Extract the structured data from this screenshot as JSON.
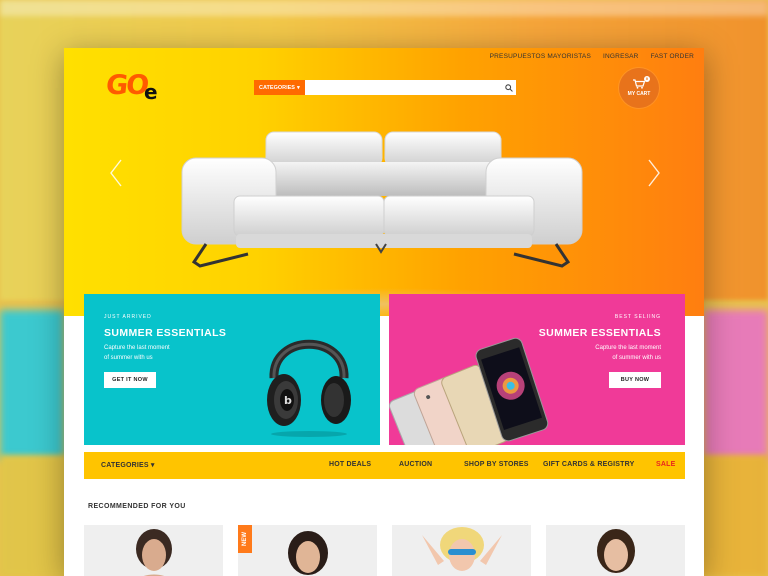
{
  "top_links": [
    "PRESUPUESTOS MAYORISTAS",
    "INGRESAR",
    "FAST ORDER"
  ],
  "logo": {
    "text_main": "GO",
    "text_small": "e"
  },
  "search": {
    "category_label": "CATEGORIES",
    "placeholder": "",
    "icon": "search-icon"
  },
  "cart": {
    "label": "MY CART",
    "count": "0",
    "icon": "cart-icon"
  },
  "hero": {
    "product": "white leather sofa",
    "gradient": [
      "#ffe000",
      "#ff7e10"
    ]
  },
  "promos": [
    {
      "tag": "JUST ARRIVED",
      "title": "SUMMER ESSENTIALS",
      "desc_line1": "Capture the last moment",
      "desc_line2": "of summer with us",
      "button": "GET IT NOW",
      "color": "#08c3cb"
    },
    {
      "tag": "BEST SELIING",
      "title": "SUMMER ESSENTIALS",
      "desc_line1": "Capture the last moment",
      "desc_line2": "of summer with us",
      "button": "BUY NOW",
      "color": "#f03a98"
    }
  ],
  "category_bar": {
    "categories_label": "CATEGORIES",
    "links": [
      "HOT DEALS",
      "AUCTION",
      "SHOP BY STORES",
      "GIFT CARDS & REGISTRY"
    ],
    "sale": "SALE",
    "color": "#ffc400"
  },
  "recommended": {
    "title": "RECOMMENDED FOR YOU",
    "new_badge": "NEW",
    "product_count": 4
  },
  "colors": {
    "accent": "#ff6a00",
    "sale": "#e8251f"
  }
}
